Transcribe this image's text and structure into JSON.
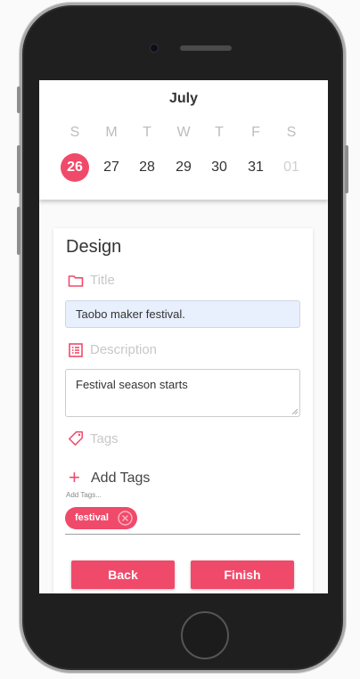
{
  "calendar": {
    "month": "July",
    "weekdays": [
      "S",
      "M",
      "T",
      "W",
      "T",
      "F",
      "S"
    ],
    "dates": [
      "26",
      "27",
      "28",
      "29",
      "30",
      "31",
      "01"
    ],
    "selected_index": 0
  },
  "form": {
    "heading": "Design",
    "title_label": "Title",
    "title_value": "Taobo maker festival.",
    "description_label": "Description",
    "description_value": "Festival season starts",
    "tags_label": "Tags",
    "add_tags_label": "Add Tags",
    "add_tags_hint": "Add Tags...",
    "tags": [
      "festival"
    ]
  },
  "buttons": {
    "back": "Back",
    "finish": "Finish"
  },
  "colors": {
    "accent": "#f04a6a",
    "input_highlight": "#e8effd"
  },
  "icons": {
    "title": "folder-icon",
    "description": "list-icon",
    "tags": "tag-icon",
    "add": "plus-icon",
    "remove_tag": "close-circle-icon"
  }
}
